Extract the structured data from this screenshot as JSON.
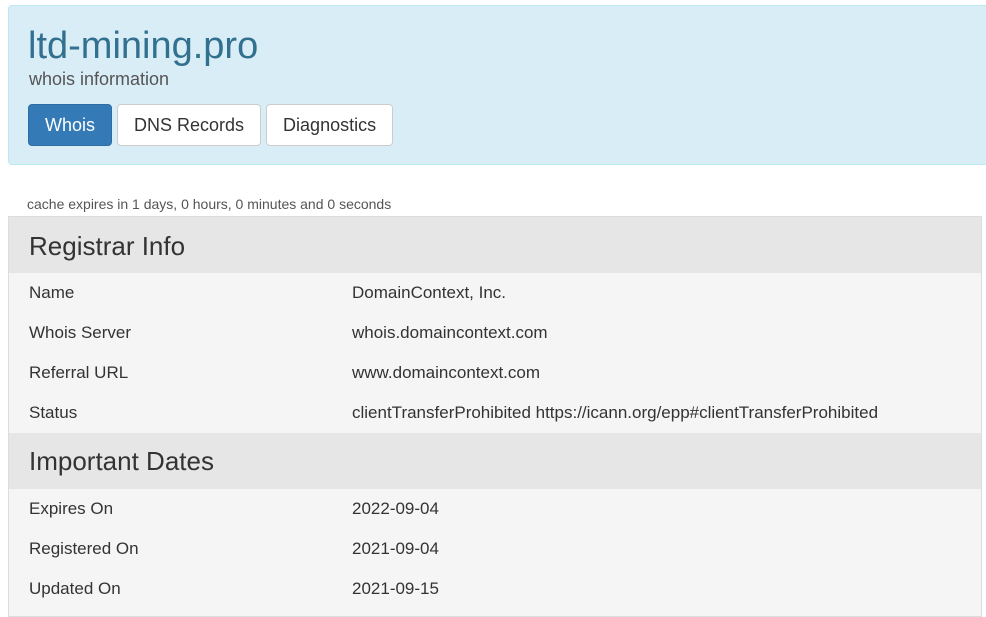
{
  "header": {
    "domain": "ltd-mining.pro",
    "subtitle": "whois information",
    "tabs": [
      {
        "label": "Whois",
        "active": true
      },
      {
        "label": "DNS Records",
        "active": false
      },
      {
        "label": "Diagnostics",
        "active": false
      }
    ]
  },
  "cache_note": "cache expires in 1 days, 0 hours, 0 minutes and 0 seconds",
  "registrar": {
    "heading": "Registrar Info",
    "rows": [
      {
        "label": "Name",
        "value": "DomainContext, Inc."
      },
      {
        "label": "Whois Server",
        "value": "whois.domaincontext.com"
      },
      {
        "label": "Referral URL",
        "value": "www.domaincontext.com"
      },
      {
        "label": "Status",
        "value": "clientTransferProhibited https://icann.org/epp#clientTransferProhibited"
      }
    ]
  },
  "dates": {
    "heading": "Important Dates",
    "rows": [
      {
        "label": "Expires On",
        "value": "2022-09-04"
      },
      {
        "label": "Registered On",
        "value": "2021-09-04"
      },
      {
        "label": "Updated On",
        "value": "2021-09-15"
      }
    ]
  },
  "colors": {
    "header_bg": "#d9edf7",
    "title": "#31708f",
    "active_tab": "#337ab7",
    "section_bg": "#e6e6e6",
    "panel_bg": "#f5f5f5"
  }
}
